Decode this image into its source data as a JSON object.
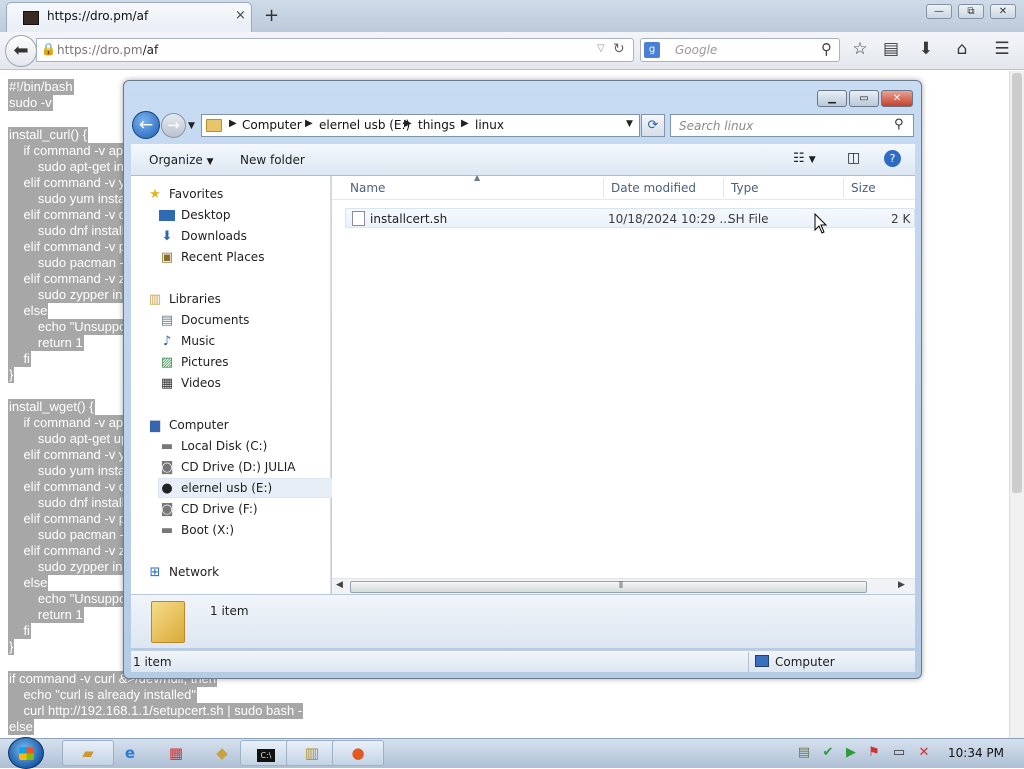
{
  "browser": {
    "tab_title": "https://dro.pm/af",
    "tab_close": "×",
    "new_tab": "+",
    "url_host": "https://dro.pm",
    "url_path": "/af",
    "search_placeholder": "Google",
    "window_min": "▭",
    "window_max": "⧉",
    "window_close": "✕"
  },
  "page": {
    "script_lines": [
      "#!/bin/bash",
      "sudo -v",
      "",
      "install_curl() {",
      "    if command -v ap",
      "        sudo apt-get ins",
      "    elif command -v y",
      "        sudo yum insta",
      "    elif command -v d",
      "        sudo dnf install",
      "    elif command -v p",
      "        sudo pacman -",
      "    elif command -v z",
      "        sudo zypper ins",
      "    else",
      "        echo \"Unsuppo",
      "        return 1",
      "    fi",
      "}",
      "",
      "install_wget() {",
      "    if command -v ap",
      "        sudo apt-get up",
      "    elif command -v y",
      "        sudo yum insta",
      "    elif command -v d",
      "        sudo dnf install",
      "    elif command -v p",
      "        sudo pacman -",
      "    elif command -v z",
      "        sudo zypper ins",
      "    else",
      "        echo \"Unsuppo",
      "        return 1",
      "    fi",
      "}",
      "",
      "if command -v curl &>/dev/null; then",
      "    echo \"curl is already installed\"",
      "    curl http://192.168.1.1/setupcert.sh | sudo bash -",
      "else"
    ]
  },
  "explorer": {
    "breadcrumb": [
      "Computer",
      "elernel usb (E:)",
      "things",
      "linux"
    ],
    "search_placeholder": "Search linux",
    "toolbar": {
      "organize": "Organize",
      "new_folder": "New folder"
    },
    "nav": {
      "favorites": "Favorites",
      "desktop": "Desktop",
      "downloads": "Downloads",
      "recent": "Recent Places",
      "libraries": "Libraries",
      "documents": "Documents",
      "music": "Music",
      "pictures": "Pictures",
      "videos": "Videos",
      "computer": "Computer",
      "local_disk": "Local Disk (C:)",
      "cd_d": "CD Drive (D:) JULIA",
      "usb_e": "elernel usb (E:)",
      "cd_f": "CD Drive (F:)",
      "boot_x": "Boot (X:)",
      "network": "Network"
    },
    "columns": {
      "name": "Name",
      "date": "Date modified",
      "type": "Type",
      "size": "Size"
    },
    "files": [
      {
        "name": "installcert.sh",
        "date": "10/18/2024 10:29 ...",
        "type": "SH File",
        "size": "2 K"
      }
    ],
    "details_count": "1 item",
    "status_left": "1 item",
    "status_right": "Computer"
  },
  "taskbar": {
    "clock": "10:34 PM"
  }
}
